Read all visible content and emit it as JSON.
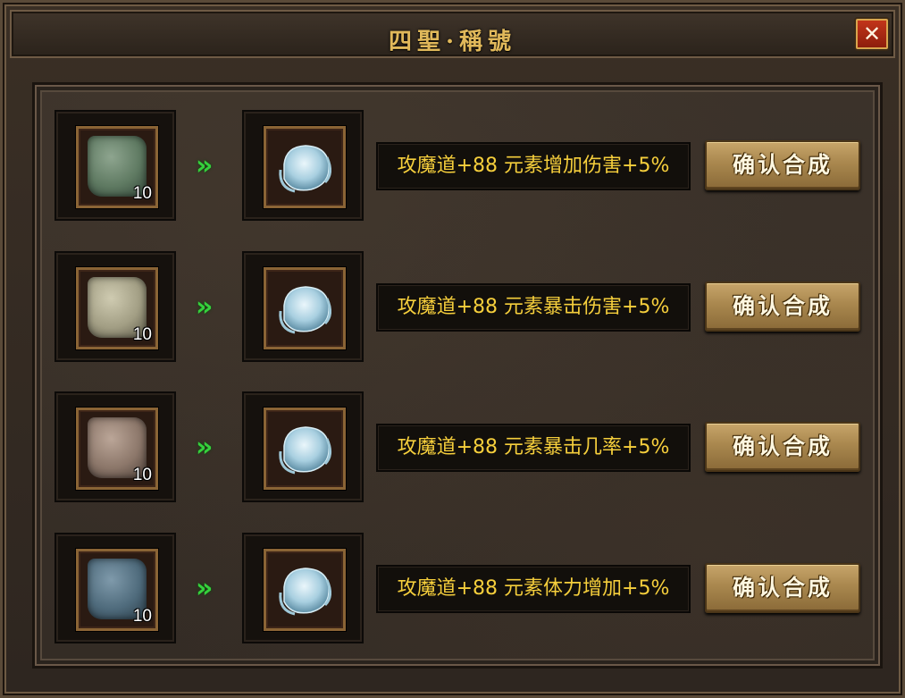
{
  "window": {
    "title": "四聖·稱號",
    "close_label": "✕"
  },
  "rows": [
    {
      "material_icon": "dragon-stone-icon",
      "material_color": "#5f7a62",
      "material_count": "10",
      "arrow": "»",
      "result_icon": "ice-orb-icon",
      "description": "攻魔道+88 元素增加伤害+5%",
      "confirm_label": "确认合成"
    },
    {
      "material_icon": "tiger-stone-icon",
      "material_color": "#a29e84",
      "material_count": "10",
      "arrow": "»",
      "result_icon": "ice-orb-icon",
      "description": "攻魔道+88 元素暴击伤害+5%",
      "confirm_label": "确认合成"
    },
    {
      "material_icon": "phoenix-stone-icon",
      "material_color": "#8c776a",
      "material_count": "10",
      "arrow": "»",
      "result_icon": "ice-orb-icon",
      "description": "攻魔道+88 元素暴击几率+5%",
      "confirm_label": "确认合成"
    },
    {
      "material_icon": "tortoise-stone-icon",
      "material_color": "#4f6b7c",
      "material_count": "10",
      "arrow": "»",
      "result_icon": "ice-orb-icon",
      "description": "攻魔道+88 元素体力增加+5%",
      "confirm_label": "确认合成"
    }
  ]
}
